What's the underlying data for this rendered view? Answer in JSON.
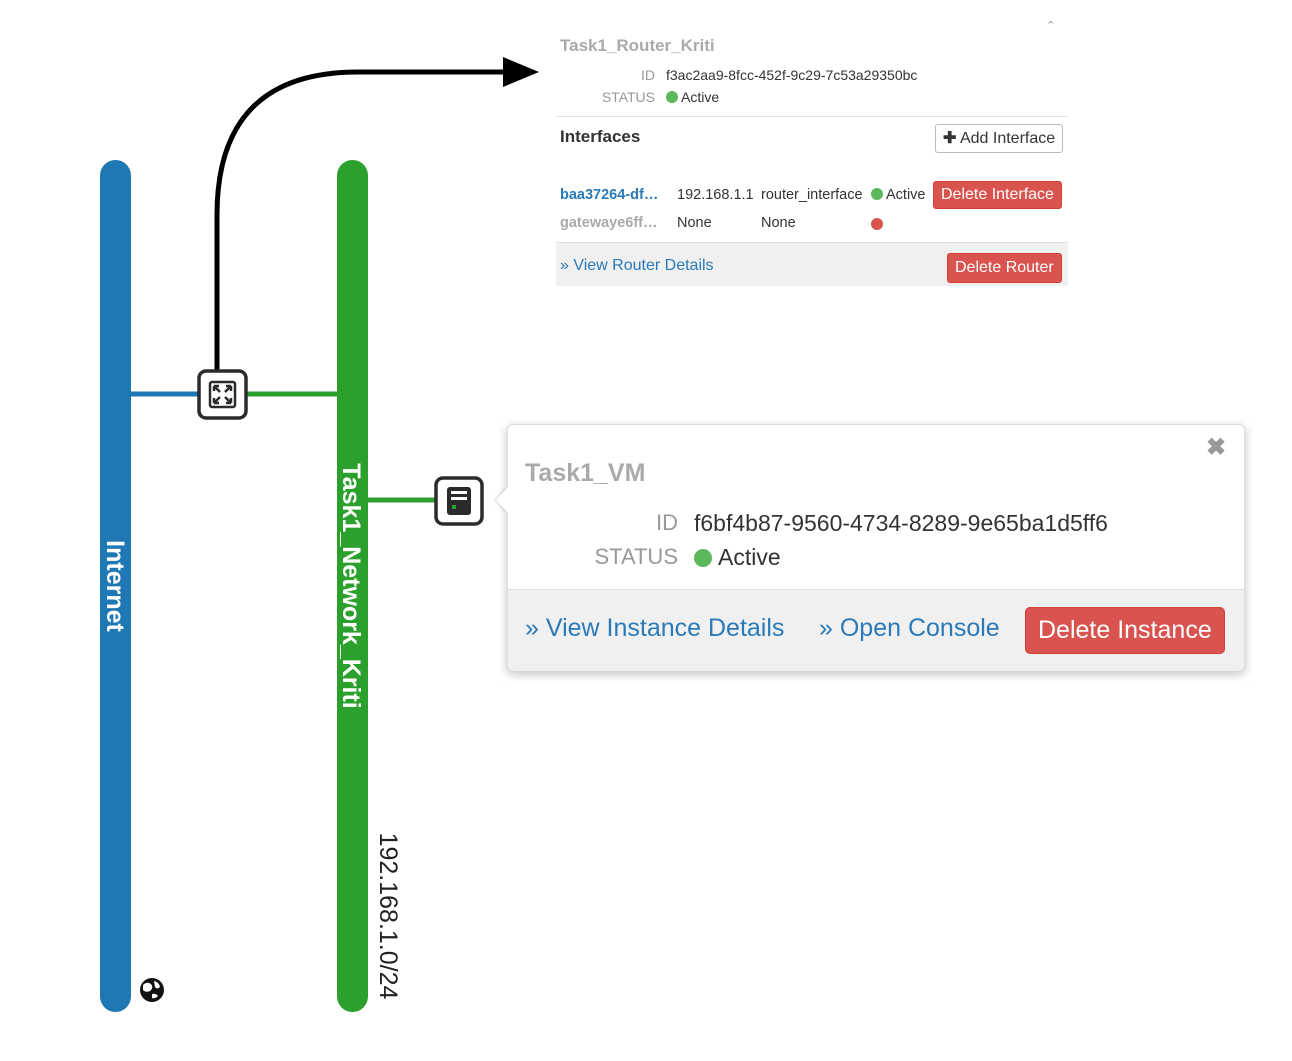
{
  "topology": {
    "external_network": {
      "name": "Internet",
      "color": "#1f77b4"
    },
    "private_network": {
      "name": "Task1_Network_Kriti",
      "cidr": "192.168.1.0/24",
      "color": "#2ca02c"
    },
    "router_node_icon": "router-icon",
    "instance_node_icon": "server-icon",
    "external_marker_icon": "globe-icon"
  },
  "router_popup": {
    "title": "Task1_Router_Kriti",
    "collapse_icon": "chevron-up-icon",
    "id_label": "ID",
    "id_value": "f3ac2aa9-8fcc-452f-9c29-7c53a29350bc",
    "status_label": "STATUS",
    "status_value": "Active",
    "interfaces_heading": "Interfaces",
    "add_interface_icon": "plus-icon",
    "add_interface_label": "Add Interface",
    "interfaces": [
      {
        "name": "baa37264-df…",
        "ip": "192.168.1.1",
        "type": "router_interface",
        "status": "Active",
        "status_color": "#5cb85c",
        "delete_label": "Delete Interface"
      },
      {
        "name": "gatewaye6ff…",
        "ip": "None",
        "type": "None",
        "status": "",
        "status_color": "#d9534f"
      }
    ],
    "view_details_label": "» View Router Details",
    "delete_label": "Delete Router"
  },
  "instance_popup": {
    "title": "Task1_VM",
    "close_icon": "close-icon",
    "id_label": "ID",
    "id_value": "f6bf4b87-9560-4734-8289-9e65ba1d5ff6",
    "status_label": "STATUS",
    "status_value": "Active",
    "view_details_label": "» View Instance Details",
    "console_label": "» Open Console",
    "delete_label": "Delete Instance"
  },
  "colors": {
    "accent_link": "#2a7ab9",
    "danger": "#d9534f",
    "active": "#5cb85c",
    "external_net": "#1f77b4",
    "private_net": "#2ca02c"
  }
}
